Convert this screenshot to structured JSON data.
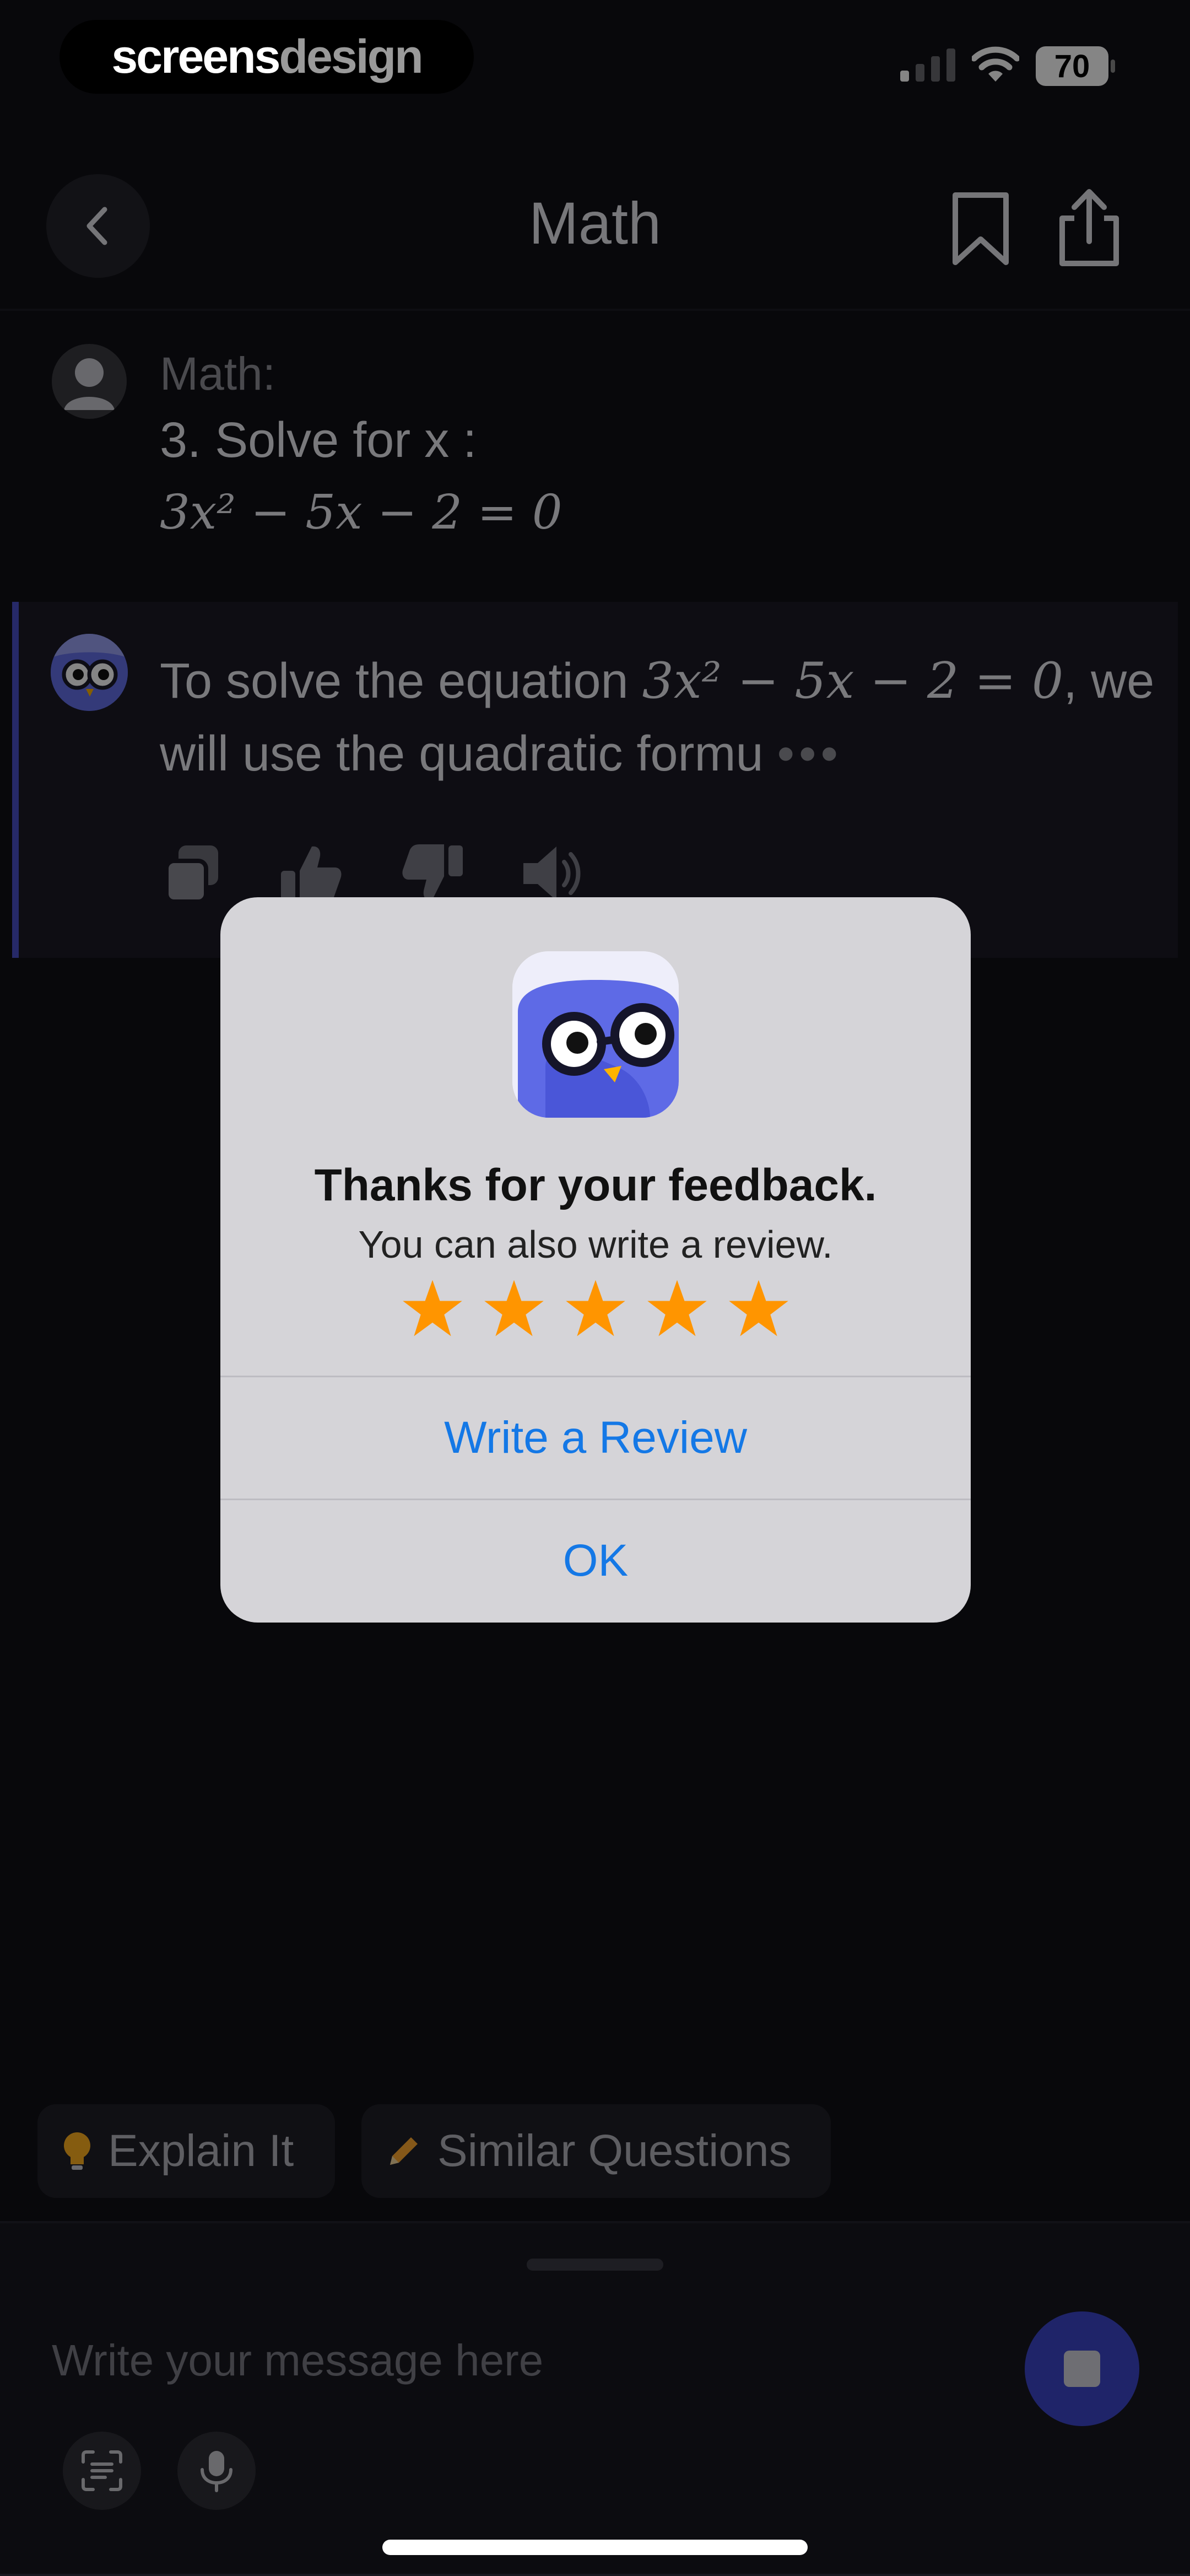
{
  "status_bar": {
    "watermark_part1": "screens",
    "watermark_part2": "design",
    "battery": "70"
  },
  "header": {
    "title": "Math"
  },
  "question": {
    "label": "Math:",
    "text": "3. Solve for x :",
    "equation": "3x² − 5x − 2 = 0"
  },
  "answer": {
    "text_before": "To solve the equation ",
    "math": "3x² − 5x − 2 = 0",
    "text_after": ", we will use the quadratic formu",
    "ellipsis": "•••"
  },
  "chips": [
    {
      "label": "Explain It",
      "icon": "lightbulb-icon"
    },
    {
      "label": "Similar Questions",
      "icon": "pencil-icon"
    }
  ],
  "composer": {
    "placeholder": "Write your message here"
  },
  "dialog": {
    "title": "Thanks for your feedback.",
    "message": "You can also write a review.",
    "rating": 5,
    "star_color": "#ff9500",
    "write_review_label": "Write a Review",
    "ok_label": "OK",
    "accent": "#1478e6"
  }
}
